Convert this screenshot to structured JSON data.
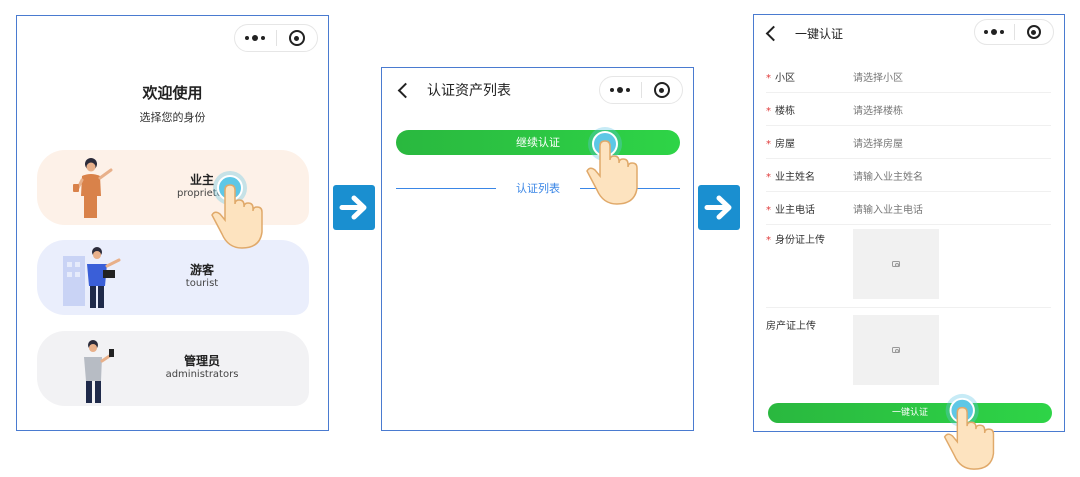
{
  "panel_role_select": {
    "capsule": {
      "more_icon": "more-dots-icon",
      "close_icon": "target-circle-icon"
    },
    "title": "欢迎使用",
    "subtitle": "选择您的身份",
    "roles": [
      {
        "name": "业主",
        "subtitle": "proprietor",
        "color": "#fdf1e8"
      },
      {
        "name": "游客",
        "subtitle": "tourist",
        "color": "#eaeefc"
      },
      {
        "name": "管理员",
        "subtitle": "administrators",
        "color": "#f2f2f4"
      }
    ]
  },
  "panel_asset_list": {
    "nav_title": "认证资产列表",
    "continue_button": "继续认证",
    "section_title": "认证列表"
  },
  "panel_auth_form": {
    "nav_title": "一键认证",
    "fields": [
      {
        "label": "小区",
        "placeholder": "请选择小区",
        "required": true
      },
      {
        "label": "楼栋",
        "placeholder": "请选择楼栋",
        "required": true
      },
      {
        "label": "房屋",
        "placeholder": "请选择房屋",
        "required": true
      },
      {
        "label": "业主姓名",
        "placeholder": "请输入业主姓名",
        "required": true
      },
      {
        "label": "业主电话",
        "placeholder": "请输入业主电话",
        "required": true
      }
    ],
    "uploads": [
      {
        "label": "身份证上传",
        "required": true
      },
      {
        "label": "房产证上传",
        "required": false
      }
    ],
    "submit_button": "一键认证",
    "required_mark": "*"
  },
  "colors": {
    "accent_green": "#2ab83f",
    "link_blue": "#3a86e6",
    "arrow_blue": "#1a8fd0",
    "frame_border": "#4a7bd0",
    "required_red": "#e03a3a"
  }
}
